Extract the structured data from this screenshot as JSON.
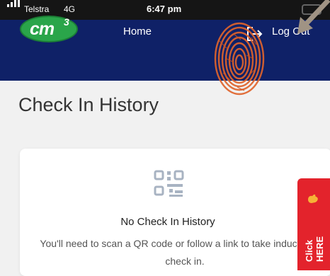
{
  "status_bar": {
    "carrier": "Telstra",
    "network": "4G",
    "time": "6:47 pm"
  },
  "navbar": {
    "logo": "cm",
    "logo_superscript": "3",
    "home": "Home",
    "logout": "Log Out"
  },
  "page": {
    "title": "Check In History"
  },
  "empty_state": {
    "title": "No Check In History",
    "description": "You'll need to scan a QR code or follow a link to take inductions or check in."
  },
  "side_tab": {
    "label": "Click HERE"
  },
  "colors": {
    "navbar": "#0f2167",
    "logo": "#2aa54a",
    "side_tab": "#e3232c"
  },
  "icons": [
    "signal-icon",
    "battery-icon",
    "logout-icon",
    "fingerprint-icon",
    "arrow-icon",
    "qr-code-icon",
    "hand-icon"
  ]
}
